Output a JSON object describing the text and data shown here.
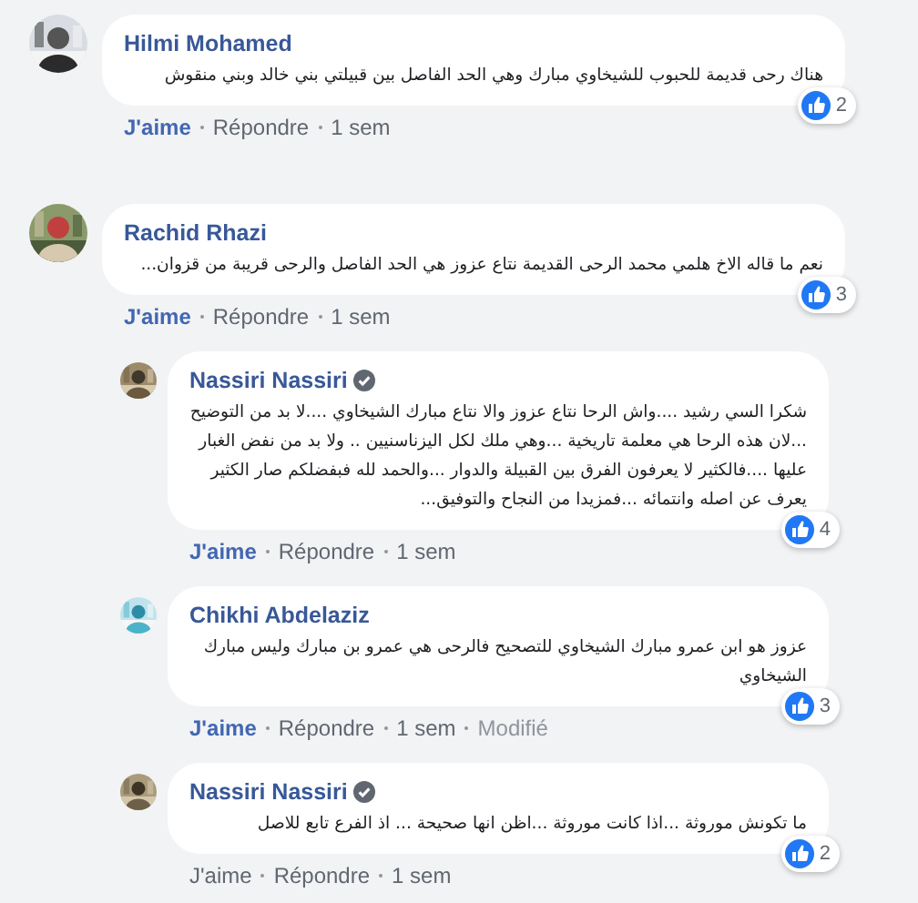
{
  "comments": [
    {
      "name": "Hilmi Mohamed",
      "verified": false,
      "text": "هناك رحى قديمة للحبوب للشيخاوي مبارك وهي الحد الفاصل بين قبيلتي بني خالد وبني منقوش",
      "reactions": "2",
      "actions": [
        {
          "kind": "like",
          "text": "J'aime",
          "liked": true
        },
        {
          "kind": "reply",
          "text": "Répondre"
        },
        {
          "kind": "time",
          "text": "1 sem"
        }
      ]
    },
    {
      "name": "Rachid Rhazi",
      "verified": false,
      "text": "نعم ما قاله الاخ هلمي محمد الرحى القديمة نتاع عزوز هي الحد الفاصل والرحى قريبة من قزوان...",
      "reactions": "3",
      "actions": [
        {
          "kind": "like",
          "text": "J'aime",
          "liked": true
        },
        {
          "kind": "reply",
          "text": "Répondre"
        },
        {
          "kind": "time",
          "text": "1 sem"
        }
      ],
      "replies": [
        {
          "name": "Nassiri Nassiri",
          "verified": true,
          "text": "شكرا السي رشيد ....واش الرحا نتاع عزوز والا نتاع مبارك الشيخاوي ....لا بد من التوضيح ...لان هذه الرحا هي معلمة تاريخية ...وهي ملك لكل اليزناسنيين .. ولا بد من نفض الغبار عليها ....فالكثير لا يعرفون الفرق بين القبيلة والدوار ...والحمد لله فبفضلكم صار الكثير يعرف عن اصله وانتمائه ...فمزيدا من النجاح والتوفيق...",
          "reactions": "4",
          "actions": [
            {
              "kind": "like",
              "text": "J'aime",
              "liked": true
            },
            {
              "kind": "reply",
              "text": "Répondre"
            },
            {
              "kind": "time",
              "text": "1 sem"
            }
          ]
        },
        {
          "name": "Chikhi Abdelaziz",
          "verified": false,
          "text": "عزوز هو ابن عمرو مبارك الشيخاوي للتصحيح فالرحى هي عمرو بن مبارك وليس مبارك الشيخاوي",
          "reactions": "3",
          "actions": [
            {
              "kind": "like",
              "text": "J'aime",
              "liked": true
            },
            {
              "kind": "reply",
              "text": "Répondre"
            },
            {
              "kind": "time",
              "text": "1 sem"
            },
            {
              "kind": "edited",
              "text": "Modifié"
            }
          ]
        },
        {
          "name": "Nassiri Nassiri",
          "verified": true,
          "text": "ما تكونش موروثة ...اذا كانت موروثة ...اظن انها صحيحة ... اذ الفرع تابع للاصل",
          "reactions": "2",
          "actions": [
            {
              "kind": "like",
              "text": "J'aime",
              "liked": false
            },
            {
              "kind": "reply",
              "text": "Répondre"
            },
            {
              "kind": "time",
              "text": "1 sem"
            }
          ]
        }
      ]
    }
  ]
}
